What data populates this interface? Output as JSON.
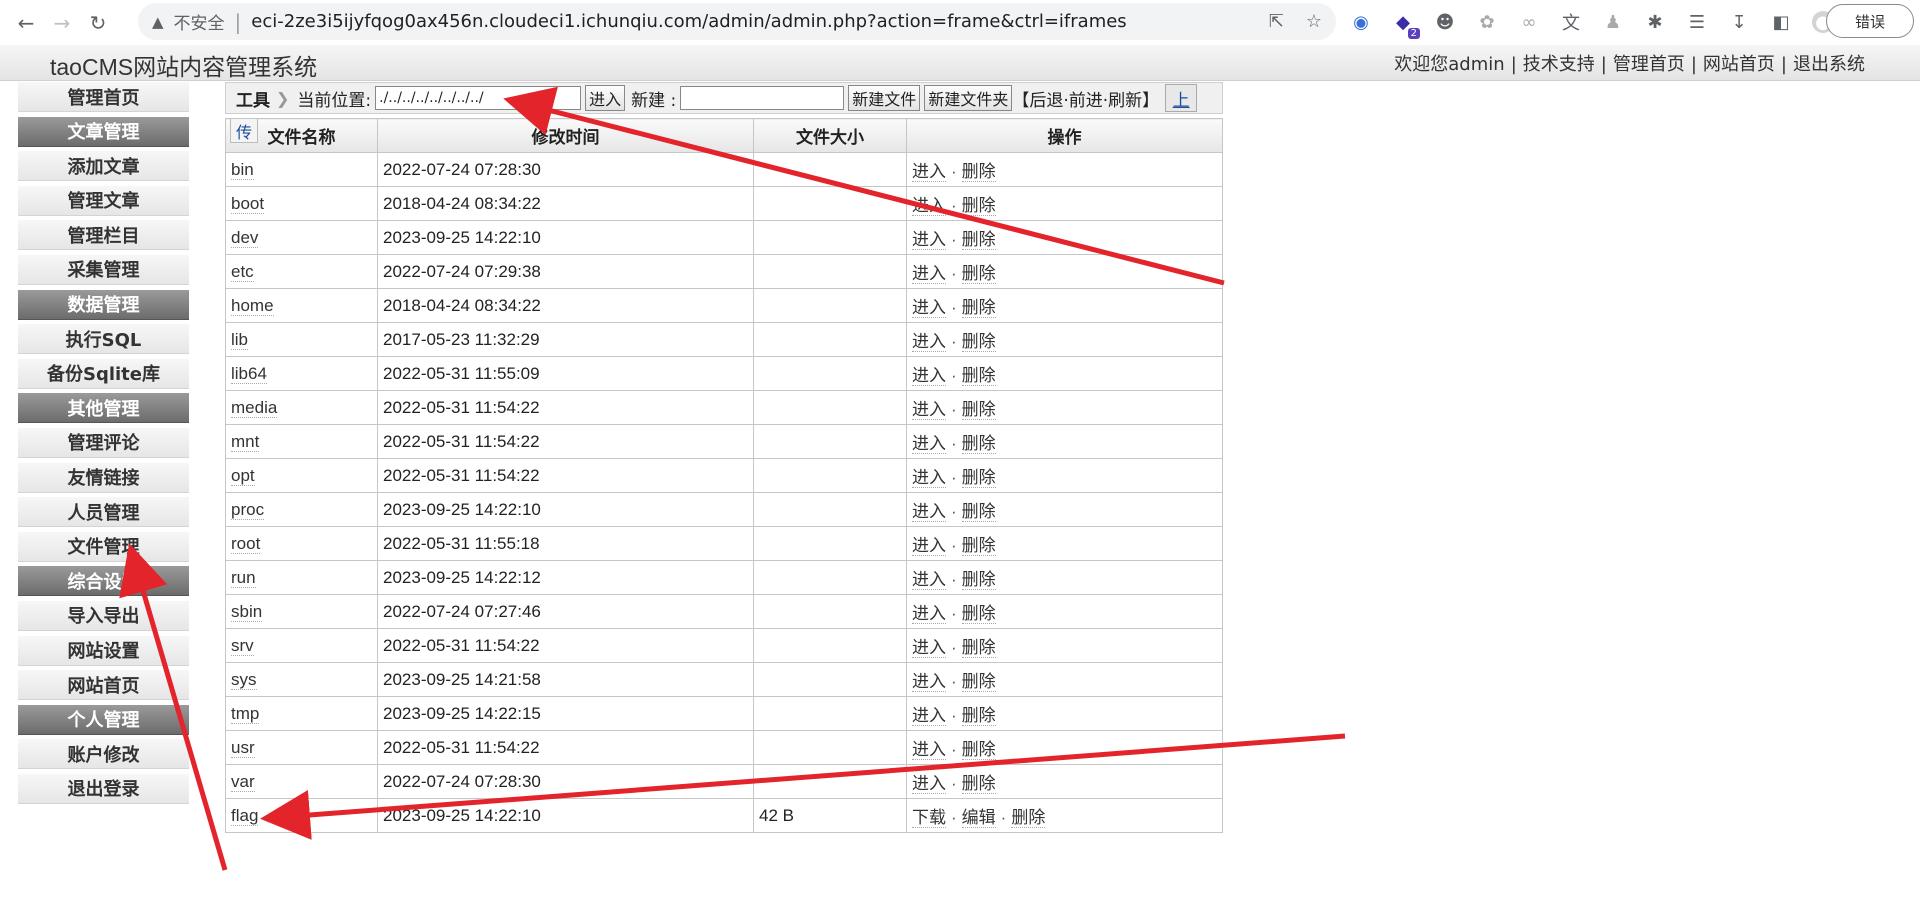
{
  "browser": {
    "insecure_label": "不安全",
    "url": "eci-2ze3i5ijyfqog0ax456n.cloudeci1.ichunqiu.com/admin/admin.php?action=frame&ctrl=iframes",
    "extension_badge": "2",
    "error_button": "错误"
  },
  "cms": {
    "title": "taoCMS网站内容管理系统",
    "topnav": {
      "welcome": "欢迎您admin",
      "support": "技术支持",
      "admin_home": "管理首页",
      "site_home": "网站首页",
      "logout": "退出系统"
    }
  },
  "sidebar": {
    "items": [
      {
        "label": "管理首页",
        "section": false
      },
      {
        "label": "文章管理",
        "section": true
      },
      {
        "label": "添加文章",
        "section": false
      },
      {
        "label": "管理文章",
        "section": false
      },
      {
        "label": "管理栏目",
        "section": false
      },
      {
        "label": "采集管理",
        "section": false
      },
      {
        "label": "数据管理",
        "section": true
      },
      {
        "label": "执行SQL",
        "section": false
      },
      {
        "label": "备份Sqlite库",
        "section": false
      },
      {
        "label": "其他管理",
        "section": true
      },
      {
        "label": "管理评论",
        "section": false
      },
      {
        "label": "友情链接",
        "section": false
      },
      {
        "label": "人员管理",
        "section": false
      },
      {
        "label": "文件管理",
        "section": false
      },
      {
        "label": "综合设置",
        "section": true
      },
      {
        "label": "导入导出",
        "section": false
      },
      {
        "label": "网站设置",
        "section": false
      },
      {
        "label": "网站首页",
        "section": false
      },
      {
        "label": "个人管理",
        "section": true
      },
      {
        "label": "账户修改",
        "section": false
      },
      {
        "label": "退出登录",
        "section": false
      }
    ]
  },
  "toolbar": {
    "tools_label": "工具",
    "location_label": "当前位置:",
    "path_value": "./../../../../../../../",
    "enter_button": "进入",
    "new_label": "新建 :",
    "new_value": "",
    "new_file_button": "新建文件",
    "new_folder_button": "新建文件夹",
    "history_text": "【后退·前进·刷新】",
    "up_button": "上"
  },
  "file_table": {
    "upload_tab": "传",
    "headers": [
      "文件名称",
      "修改时间",
      "文件大小",
      "操作"
    ],
    "rows": [
      {
        "name": "bin",
        "time": "2022-07-24 07:28:30",
        "size": "",
        "ops": [
          "进入",
          "删除"
        ]
      },
      {
        "name": "boot",
        "time": "2018-04-24 08:34:22",
        "size": "",
        "ops": [
          "进入",
          "删除"
        ]
      },
      {
        "name": "dev",
        "time": "2023-09-25 14:22:10",
        "size": "",
        "ops": [
          "进入",
          "删除"
        ]
      },
      {
        "name": "etc",
        "time": "2022-07-24 07:29:38",
        "size": "",
        "ops": [
          "进入",
          "删除"
        ]
      },
      {
        "name": "home",
        "time": "2018-04-24 08:34:22",
        "size": "",
        "ops": [
          "进入",
          "删除"
        ]
      },
      {
        "name": "lib",
        "time": "2017-05-23 11:32:29",
        "size": "",
        "ops": [
          "进入",
          "删除"
        ]
      },
      {
        "name": "lib64",
        "time": "2022-05-31 11:55:09",
        "size": "",
        "ops": [
          "进入",
          "删除"
        ]
      },
      {
        "name": "media",
        "time": "2022-05-31 11:54:22",
        "size": "",
        "ops": [
          "进入",
          "删除"
        ]
      },
      {
        "name": "mnt",
        "time": "2022-05-31 11:54:22",
        "size": "",
        "ops": [
          "进入",
          "删除"
        ]
      },
      {
        "name": "opt",
        "time": "2022-05-31 11:54:22",
        "size": "",
        "ops": [
          "进入",
          "删除"
        ]
      },
      {
        "name": "proc",
        "time": "2023-09-25 14:22:10",
        "size": "",
        "ops": [
          "进入",
          "删除"
        ]
      },
      {
        "name": "root",
        "time": "2022-05-31 11:55:18",
        "size": "",
        "ops": [
          "进入",
          "删除"
        ]
      },
      {
        "name": "run",
        "time": "2023-09-25 14:22:12",
        "size": "",
        "ops": [
          "进入",
          "删除"
        ]
      },
      {
        "name": "sbin",
        "time": "2022-07-24 07:27:46",
        "size": "",
        "ops": [
          "进入",
          "删除"
        ]
      },
      {
        "name": "srv",
        "time": "2022-05-31 11:54:22",
        "size": "",
        "ops": [
          "进入",
          "删除"
        ]
      },
      {
        "name": "sys",
        "time": "2023-09-25 14:21:58",
        "size": "",
        "ops": [
          "进入",
          "删除"
        ]
      },
      {
        "name": "tmp",
        "time": "2023-09-25 14:22:15",
        "size": "",
        "ops": [
          "进入",
          "删除"
        ]
      },
      {
        "name": "usr",
        "time": "2022-05-31 11:54:22",
        "size": "",
        "ops": [
          "进入",
          "删除"
        ]
      },
      {
        "name": "var",
        "time": "2022-07-24 07:28:30",
        "size": "",
        "ops": [
          "进入",
          "删除"
        ]
      },
      {
        "name": "flag",
        "time": "2023-09-25 14:22:10",
        "size": "42 B",
        "ops": [
          "下载",
          "编辑",
          "删除"
        ]
      }
    ]
  },
  "colors": {
    "annotation_arrow": "#e3242b",
    "sidebar_section_bg": "#7d7d7d",
    "link_blue": "#1a4b9c"
  }
}
